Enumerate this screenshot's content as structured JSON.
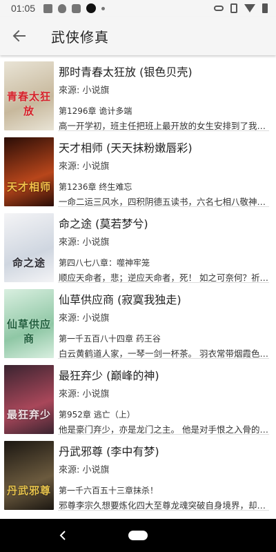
{
  "status_bar": {
    "time": "01:05",
    "left_icons": [
      "image-icon",
      "qq-icon",
      "app-icon",
      "record-dot-icon",
      "dot-icon"
    ],
    "right_icons": [
      "key-icon",
      "vibrate-icon",
      "wifi-icon",
      "battery-icon"
    ]
  },
  "toolbar": {
    "back_icon": "arrow-left-icon",
    "title": "武侠修真"
  },
  "books": [
    {
      "title": "那时青春太狂放 (银色贝壳)",
      "source": "來源: 小说旗",
      "chapter": "第1296章 诡计多端",
      "desc": "高一开学初，班主任把班上最开放的女生安排到了我的…",
      "cover_text": "青春太狂放",
      "cover_colors": [
        "#e9e4d6",
        "#c7b89c",
        "#d6212b"
      ]
    },
    {
      "title": "天才相师 (天天抹粉嫩唇彩)",
      "source": "來源: 小说旗",
      "chapter": "第1236章 终生难忘",
      "desc": "一命二运三风水，四积阴德五读书，六名七相八敬神，…",
      "cover_text": "天才相师",
      "cover_colors": [
        "#2a0d07",
        "#b8461b",
        "#f3c04a"
      ]
    },
    {
      "title": "命之途 (莫若梦兮)",
      "source": "來源: 小说旗",
      "chapter": "第四八七八章：噬神牢笼",
      "desc": "顺应天命者，悲；逆应天命者，死！ 如之可奈何？祈求…",
      "cover_text": "命之途",
      "cover_colors": [
        "#f4f4f6",
        "#cfd6e0",
        "#2b2b33"
      ]
    },
    {
      "title": "仙草供应商 (寂寞我独走)",
      "source": "來源: 小说旗",
      "chapter": "第一千五百八十四章 药王谷",
      "desc": "白云黄鹤道人家，一琴一剑一杯茶。 羽衣常带烟霞色，…",
      "cover_text": "仙草供应商",
      "cover_colors": [
        "#d9efe0",
        "#8fc7a5",
        "#1f5d3c"
      ]
    },
    {
      "title": "最狂弃少 (巅峰的神)",
      "source": "來源: 小说旗",
      "chapter": "第952章 逃亡（上）",
      "desc": "他是豪门弃少，亦是龙门之主。 他是对手恨之入骨的冷…",
      "cover_text": "最狂弃少",
      "cover_colors": [
        "#3a2430",
        "#a9475a",
        "#f1e1e4"
      ]
    },
    {
      "title": "丹武邪尊 (李中有梦)",
      "source": "來源: 小说旗",
      "chapter": "第一千六百五十三章抹杀！",
      "desc": "邪尊李宗久想要炼化四大至尊龙魂突破自身境界，却不…",
      "cover_text": "丹武邪尊",
      "cover_colors": [
        "#1b1712",
        "#6b5a3e",
        "#e7c34c"
      ]
    }
  ],
  "nav_bar": {
    "back_icon": "nav-back-icon",
    "home_icon": "nav-home-pill"
  }
}
